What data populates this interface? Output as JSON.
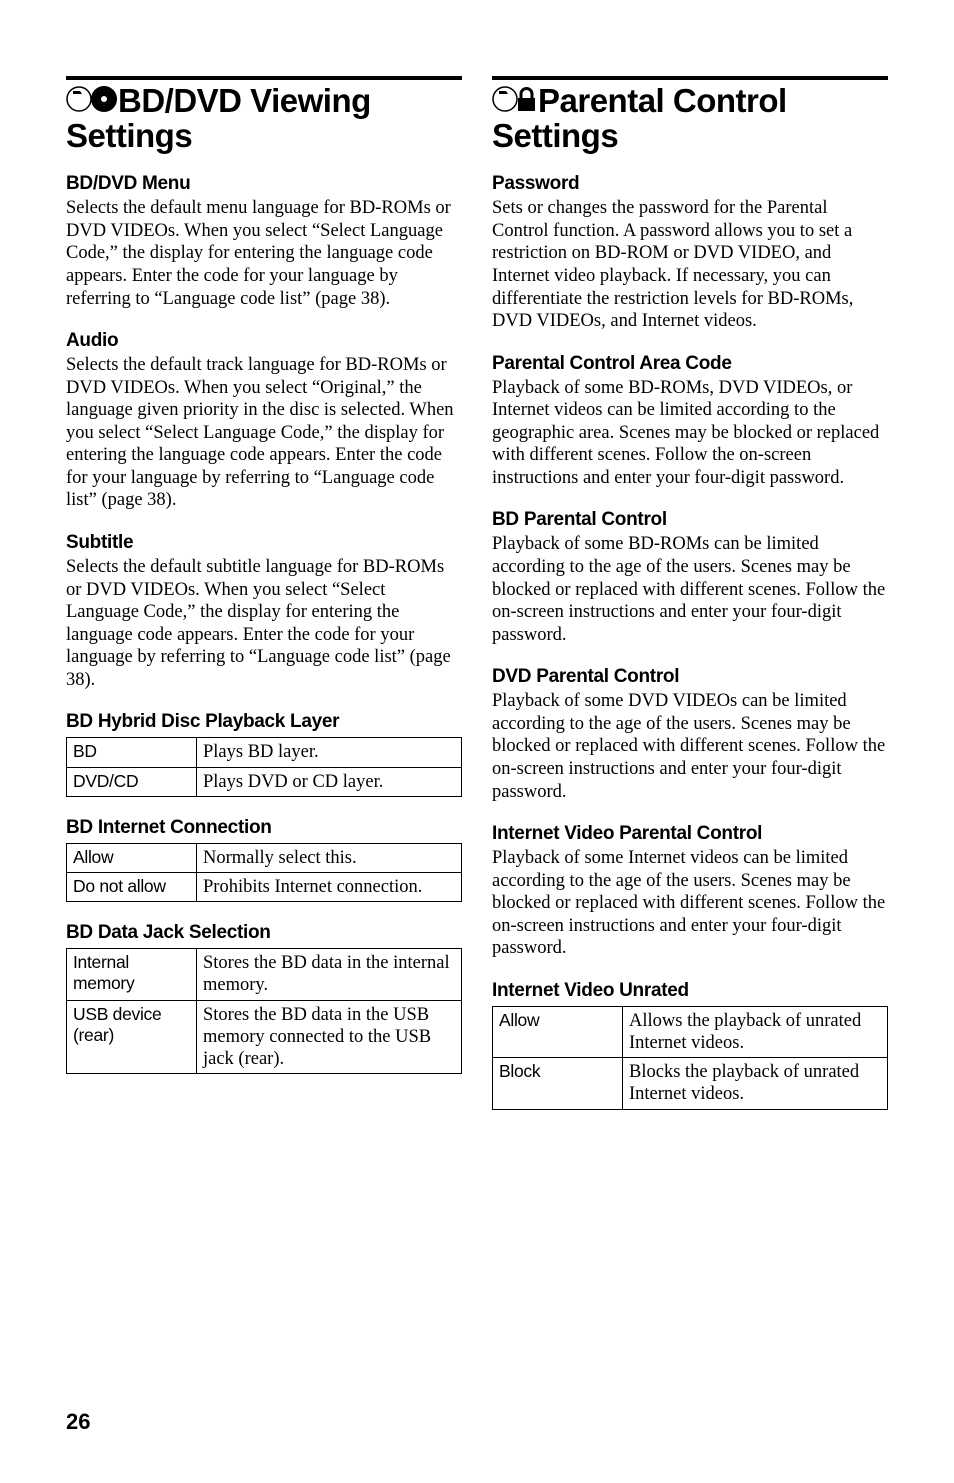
{
  "page_number": "26",
  "left": {
    "title": "BD/DVD Viewing Settings",
    "bd_dvd_menu": {
      "h": "BD/DVD Menu",
      "p": "Selects the default menu language for BD-ROMs or DVD VIDEOs.\nWhen you select “Select Language Code,” the display for entering the language code appears. Enter the code for your language by referring to “Language code list” (page 38)."
    },
    "audio": {
      "h": "Audio",
      "p": "Selects the default track language for BD-ROMs or DVD VIDEOs.\nWhen you select “Original,” the language given priority in the disc is selected.\nWhen you select “Select Language Code,” the display for entering the language code appears. Enter the code for your language by referring to “Language code list” (page 38)."
    },
    "subtitle": {
      "h": "Subtitle",
      "p": "Selects the default subtitle language for BD-ROMs or DVD VIDEOs.\nWhen you select “Select Language Code,” the display for entering the language code appears. Enter the code for your language by referring to “Language code list” (page 38)."
    },
    "hybrid": {
      "h": "BD Hybrid Disc Playback Layer",
      "rows": [
        [
          "BD",
          "Plays BD layer."
        ],
        [
          "DVD/CD",
          "Plays DVD or CD layer."
        ]
      ]
    },
    "internet": {
      "h": "BD Internet Connection",
      "rows": [
        [
          "Allow",
          "Normally select this."
        ],
        [
          "Do not allow",
          "Prohibits Internet connection."
        ]
      ]
    },
    "jack": {
      "h": "BD Data Jack Selection",
      "rows": [
        [
          "Internal memory",
          "Stores the BD data in the internal memory."
        ],
        [
          "USB device (rear)",
          "Stores the BD data in the USB memory connected to the USB jack (rear)."
        ]
      ]
    }
  },
  "right": {
    "title": "Parental Control Settings",
    "password": {
      "h": "Password",
      "p": "Sets or changes the password for the Parental Control function. A password allows you to set a restriction on BD-ROM or DVD VIDEO, and Internet video playback. If necessary, you can differentiate the restriction levels for BD-ROMs, DVD VIDEOs, and Internet videos."
    },
    "area": {
      "h": "Parental Control Area Code",
      "p": "Playback of some BD-ROMs, DVD VIDEOs, or Internet videos can be limited according to the geographic area. Scenes may be blocked or replaced with different scenes. Follow the on-screen instructions and enter your four-digit password."
    },
    "bd_pc": {
      "h": "BD Parental Control",
      "p": "Playback of some BD-ROMs can be limited according to the age of the users. Scenes may be blocked or replaced with different scenes. Follow the on-screen instructions and enter your four-digit password."
    },
    "dvd_pc": {
      "h": "DVD Parental Control",
      "p": "Playback of some DVD VIDEOs can be limited according to the age of the users. Scenes may be blocked or replaced with different scenes. Follow the on-screen instructions and enter your four-digit password."
    },
    "iv_pc": {
      "h": "Internet Video Parental Control",
      "p": "Playback of some Internet videos can be limited according to the age of the users. Scenes may be blocked or replaced with different scenes. Follow the on-screen instructions and enter your four-digit password."
    },
    "iv_unrated": {
      "h": "Internet Video Unrated",
      "rows": [
        [
          "Allow",
          "Allows the playback of unrated Internet videos."
        ],
        [
          "Block",
          "Blocks the playback of unrated Internet videos."
        ]
      ]
    }
  }
}
